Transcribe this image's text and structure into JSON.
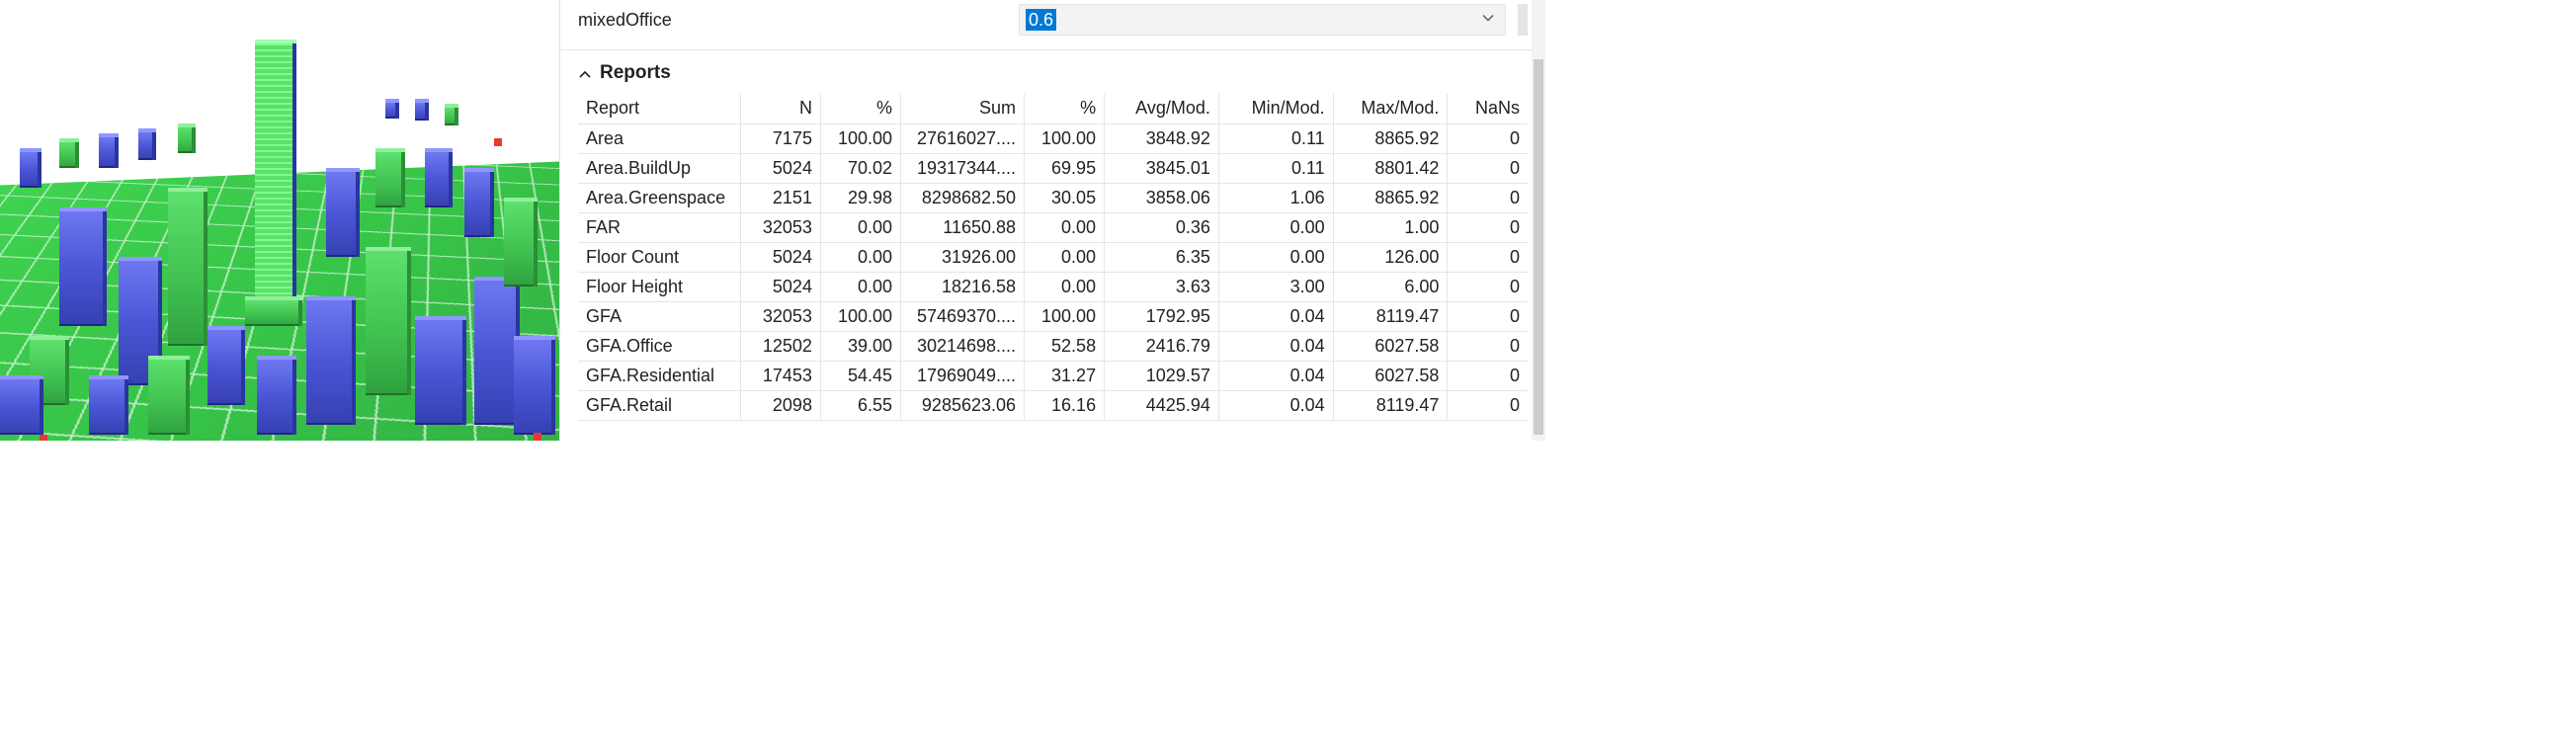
{
  "attribute": {
    "label": "mixedOffice",
    "value": "0.6"
  },
  "reports": {
    "title": "Reports",
    "columns": [
      "Report",
      "N",
      "%",
      "Sum",
      "%",
      "Avg/Mod.",
      "Min/Mod.",
      "Max/Mod.",
      "NaNs"
    ],
    "rows": [
      {
        "report": "Area",
        "n": "7175",
        "p1": "100.00",
        "sum": "27616027....",
        "p2": "100.00",
        "avg": "3848.92",
        "min": "0.11",
        "max": "8865.92",
        "nan": "0"
      },
      {
        "report": "Area.BuildUp",
        "n": "5024",
        "p1": "70.02",
        "sum": "19317344....",
        "p2": "69.95",
        "avg": "3845.01",
        "min": "0.11",
        "max": "8801.42",
        "nan": "0"
      },
      {
        "report": "Area.Greenspace",
        "n": "2151",
        "p1": "29.98",
        "sum": "8298682.50",
        "p2": "30.05",
        "avg": "3858.06",
        "min": "1.06",
        "max": "8865.92",
        "nan": "0"
      },
      {
        "report": "FAR",
        "n": "32053",
        "p1": "0.00",
        "sum": "11650.88",
        "p2": "0.00",
        "avg": "0.36",
        "min": "0.00",
        "max": "1.00",
        "nan": "0"
      },
      {
        "report": "Floor Count",
        "n": "5024",
        "p1": "0.00",
        "sum": "31926.00",
        "p2": "0.00",
        "avg": "6.35",
        "min": "0.00",
        "max": "126.00",
        "nan": "0"
      },
      {
        "report": "Floor Height",
        "n": "5024",
        "p1": "0.00",
        "sum": "18216.58",
        "p2": "0.00",
        "avg": "3.63",
        "min": "3.00",
        "max": "6.00",
        "nan": "0"
      },
      {
        "report": "GFA",
        "n": "32053",
        "p1": "100.00",
        "sum": "57469370....",
        "p2": "100.00",
        "avg": "1792.95",
        "min": "0.04",
        "max": "8119.47",
        "nan": "0"
      },
      {
        "report": "GFA.Office",
        "n": "12502",
        "p1": "39.00",
        "sum": "30214698....",
        "p2": "52.58",
        "avg": "2416.79",
        "min": "0.04",
        "max": "6027.58",
        "nan": "0"
      },
      {
        "report": "GFA.Residential",
        "n": "17453",
        "p1": "54.45",
        "sum": "17969049....",
        "p2": "31.27",
        "avg": "1029.57",
        "min": "0.04",
        "max": "6027.58",
        "nan": "0"
      },
      {
        "report": "GFA.Retail",
        "n": "2098",
        "p1": "6.55",
        "sum": "9285623.06",
        "p2": "16.16",
        "avg": "4425.94",
        "min": "0.04",
        "max": "8119.47",
        "nan": "0"
      }
    ]
  },
  "colors": {
    "selection": "#0078d4",
    "building_blue": "#4a55d6",
    "building_green": "#3fc04f",
    "ground": "#4bd15a"
  },
  "icons": {
    "chevron_down": "chevron-down-icon",
    "chevron_up": "chevron-up-icon"
  }
}
